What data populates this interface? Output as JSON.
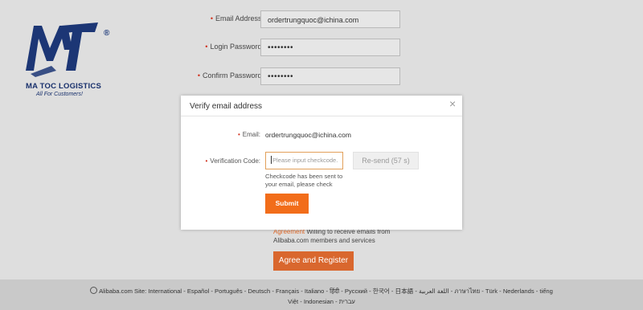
{
  "logo": {
    "name": "MA TOC LOGISTICS",
    "tagline": "All For Customers!",
    "registered": "®"
  },
  "form": {
    "email_label": "Email Address:",
    "email_value": "ordertrungquoc@ichina.com",
    "password_label": "Login Password:",
    "password_value": "••••••••",
    "confirm_label": "Confirm Password:",
    "confirm_value": "••••••••",
    "agreement_link": "Agreement",
    "agreement_text1": " Willing to receive emails from",
    "agreement_text2": "Alibaba.com members and services",
    "register_button": "Agree and Register",
    "required_mark": "•"
  },
  "modal": {
    "title": "Verify email address",
    "close": "×",
    "email_label": "Email:",
    "email_value": "ordertrungquoc@ichina.com",
    "code_label": "Verification Code:",
    "code_placeholder": "Please input checkcode.",
    "resend_label": "Re-send (57 s)",
    "hint": "Checkcode has been sent to your email, please check",
    "submit_label": "Submit"
  },
  "footer": {
    "line1": "Alibaba.com Site: International - Español - Português - Deutsch - Français - Italiano - हिंदी - Pусский - 한국어 - 日本語 - اللغة العربية - ภาษาไทย - Türk - Nederlands - tiếng",
    "line2": "Việt - Indonesian - עברית"
  },
  "colors": {
    "brand_blue": "#18306c",
    "accent_orange": "#f26d1a",
    "required_red": "#d0311d"
  }
}
